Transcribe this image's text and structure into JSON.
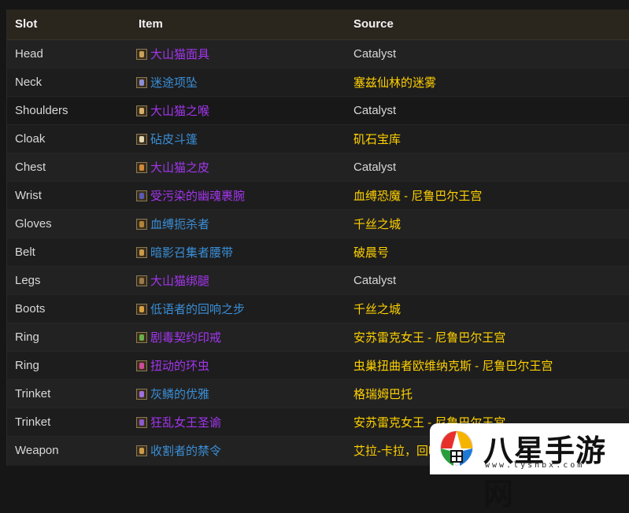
{
  "table": {
    "headers": {
      "slot": "Slot",
      "item": "Item",
      "source": "Source"
    },
    "rows": [
      {
        "slot": "Head",
        "item": "大山猫面具",
        "item_color": "purple",
        "icon": "helm-icon",
        "source": "Catalyst",
        "source_type": "catalyst"
      },
      {
        "slot": "Neck",
        "item": "迷途项坠",
        "item_color": "blue",
        "icon": "necklace-icon",
        "source": "塞兹仙林的迷雾",
        "source_type": "location"
      },
      {
        "slot": "Shoulders",
        "item": "大山猫之喉",
        "item_color": "purple",
        "icon": "shoulder-icon",
        "source": "Catalyst",
        "source_type": "catalyst"
      },
      {
        "slot": "Cloak",
        "item": "砧皮斗篷",
        "item_color": "blue",
        "icon": "cloak-icon",
        "source": "矶石宝库",
        "source_type": "location"
      },
      {
        "slot": "Chest",
        "item": "大山猫之皮",
        "item_color": "purple",
        "icon": "chest-armor-icon",
        "source": "Catalyst",
        "source_type": "catalyst"
      },
      {
        "slot": "Wrist",
        "item": "受污染的幽魂裹腕",
        "item_color": "purple",
        "icon": "bracer-icon",
        "source": "血缚恐魔 - 尼鲁巴尔王宫",
        "source_type": "location"
      },
      {
        "slot": "Gloves",
        "item": "血缚扼杀者",
        "item_color": "blue",
        "icon": "gloves-icon",
        "source": "千丝之城",
        "source_type": "location"
      },
      {
        "slot": "Belt",
        "item": "暗影召集者腰带",
        "item_color": "blue",
        "icon": "belt-icon",
        "source": "破晨号",
        "source_type": "location"
      },
      {
        "slot": "Legs",
        "item": "大山猫绑腿",
        "item_color": "purple",
        "icon": "legs-icon",
        "source": "Catalyst",
        "source_type": "catalyst"
      },
      {
        "slot": "Boots",
        "item": "低语者的回响之步",
        "item_color": "blue",
        "icon": "boots-icon",
        "source": "千丝之城",
        "source_type": "location"
      },
      {
        "slot": "Ring",
        "item": "剧毒契约印戒",
        "item_color": "purple",
        "icon": "ring-icon",
        "source": "安苏雷克女王 - 尼鲁巴尔王宫",
        "source_type": "location"
      },
      {
        "slot": "Ring",
        "item": "扭动的环虫",
        "item_color": "purple",
        "icon": "ring-worm-icon",
        "source": "虫巢扭曲者欧维纳克斯 - 尼鲁巴尔王宫",
        "source_type": "location"
      },
      {
        "slot": "Trinket",
        "item": "灰鳞的优雅",
        "item_color": "blue",
        "icon": "trinket-icon",
        "source": "格瑞姆巴托",
        "source_type": "location"
      },
      {
        "slot": "Trinket",
        "item": "狂乱女王圣谕",
        "item_color": "purple",
        "icon": "trinket-queen-icon",
        "source": "安苏雷克女王 - 尼鲁巴尔王宫",
        "source_type": "location"
      },
      {
        "slot": "Weapon",
        "item": "收割者的禁令",
        "item_color": "blue",
        "icon": "staff-icon",
        "source": "艾拉-卡拉，回响之城",
        "source_type": "location"
      }
    ],
    "highlighted_row": 2
  },
  "colors": {
    "epic": "#a335ee",
    "rare": "#3a8ed6",
    "location": "#ffd100",
    "header_bg": "#2a251d"
  },
  "watermark": {
    "brand": "八星手游网",
    "url": "www.lyshbx.com"
  }
}
